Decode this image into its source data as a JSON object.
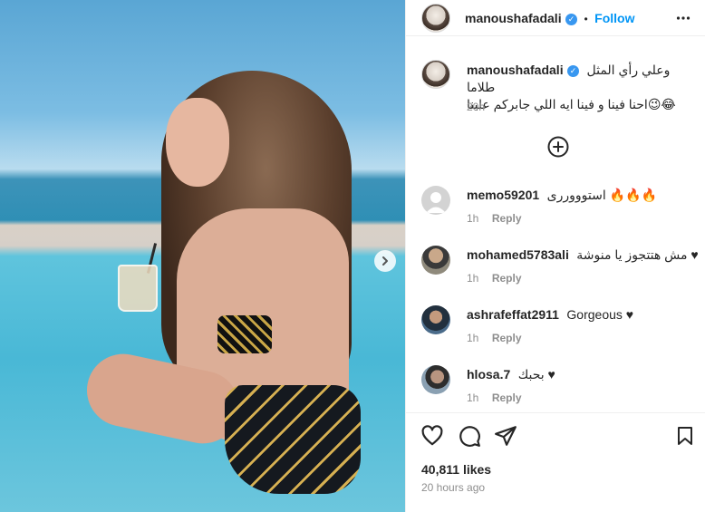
{
  "post": {
    "username": "manoushafadali",
    "dot": "•",
    "follow_label": "Follow",
    "more_icon": "more-horizontal-icon",
    "caption_line1": "وعلي رأي المثل طلاما",
    "caption_line2": "احنا فينا و فينا ايه اللي جابركم علينا😉😂",
    "caption_time": "20h",
    "load_more_icon": "plus-circle-icon",
    "likes": "40,811 likes",
    "posted": "20 hours ago"
  },
  "comments": [
    {
      "user": "memo59201",
      "text": "استوووررى 🔥🔥🔥",
      "time": "1h",
      "reply": "Reply",
      "avatar_color": "#c7c7c7"
    },
    {
      "user": "mohamed5783ali",
      "text": "مش هتتجوز يا منوشة ♥",
      "time": "1h",
      "reply": "Reply",
      "avatar_color": "#7a6a52"
    },
    {
      "user": "ashrafeffat2911",
      "text": "Gorgeous ♥",
      "time": "1h",
      "reply": "Reply",
      "avatar_color": "#3b5a78"
    },
    {
      "user": "hlosa.7",
      "text": "بحبك ♥⁣",
      "time": "1h",
      "reply": "Reply",
      "avatar_color": "#6d7f8f"
    }
  ],
  "colors": {
    "accent": "#0095f6",
    "verified": "#3897f0",
    "text": "#262626",
    "muted": "#8e8e8e"
  }
}
